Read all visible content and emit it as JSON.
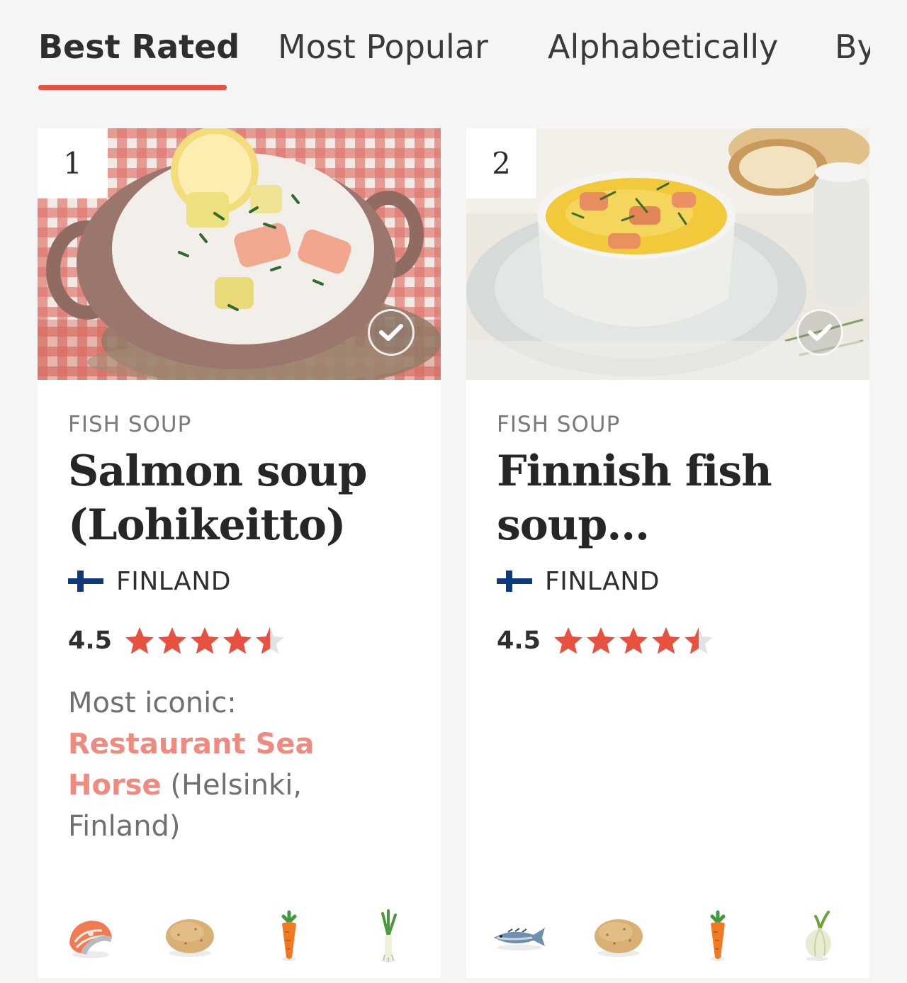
{
  "tabs": [
    {
      "label": "Best Rated",
      "active": true
    },
    {
      "label": "Most Popular",
      "active": false
    },
    {
      "label": "Alphabetically",
      "active": false
    },
    {
      "label": "By",
      "active": false
    }
  ],
  "accent_color": "#e8503f",
  "cards": [
    {
      "rank": "1",
      "category": "FISH SOUP",
      "title": "Salmon soup (Lohikeitto)",
      "country": "FINLAND",
      "rating": "4.5",
      "rating_value": 4.5,
      "iconic_label": "Most iconic:",
      "iconic_place": "Restaurant Sea Horse",
      "iconic_location": " (Helsinki, Finland)",
      "ingredients": [
        "salmon-icon",
        "potato-icon",
        "carrot-icon",
        "leek-icon"
      ]
    },
    {
      "rank": "2",
      "category": "FISH SOUP",
      "title": "Finnish fish soup...",
      "country": "FINLAND",
      "rating": "4.5",
      "rating_value": 4.5,
      "ingredients": [
        "fish-icon",
        "potato-icon",
        "carrot-icon",
        "onion-icon"
      ]
    }
  ]
}
